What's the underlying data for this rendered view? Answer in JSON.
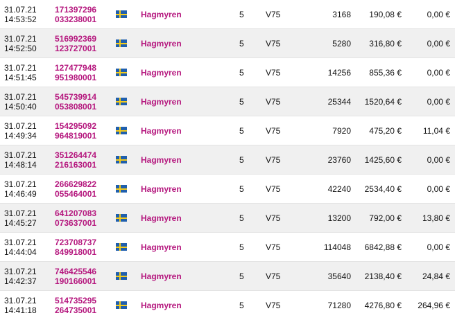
{
  "rows": [
    {
      "date": "31.07.21",
      "time": "14:53:52",
      "ticket_line1": "171397296",
      "ticket_line2": "033238001",
      "flag_icon": "sweden-flag-icon",
      "track": "Hagmyren",
      "race": "5",
      "game": "V75",
      "rows": "3168",
      "cost": "190,08 €",
      "winnings": "0,00 €"
    },
    {
      "date": "31.07.21",
      "time": "14:52:50",
      "ticket_line1": "516992369",
      "ticket_line2": "123727001",
      "flag_icon": "sweden-flag-icon",
      "track": "Hagmyren",
      "race": "5",
      "game": "V75",
      "rows": "5280",
      "cost": "316,80 €",
      "winnings": "0,00 €"
    },
    {
      "date": "31.07.21",
      "time": "14:51:45",
      "ticket_line1": "127477948",
      "ticket_line2": "951980001",
      "flag_icon": "sweden-flag-icon",
      "track": "Hagmyren",
      "race": "5",
      "game": "V75",
      "rows": "14256",
      "cost": "855,36 €",
      "winnings": "0,00 €"
    },
    {
      "date": "31.07.21",
      "time": "14:50:40",
      "ticket_line1": "545739914",
      "ticket_line2": "053808001",
      "flag_icon": "sweden-flag-icon",
      "track": "Hagmyren",
      "race": "5",
      "game": "V75",
      "rows": "25344",
      "cost": "1520,64 €",
      "winnings": "0,00 €"
    },
    {
      "date": "31.07.21",
      "time": "14:49:34",
      "ticket_line1": "154295092",
      "ticket_line2": "964819001",
      "flag_icon": "sweden-flag-icon",
      "track": "Hagmyren",
      "race": "5",
      "game": "V75",
      "rows": "7920",
      "cost": "475,20 €",
      "winnings": "11,04 €"
    },
    {
      "date": "31.07.21",
      "time": "14:48:14",
      "ticket_line1": "351264474",
      "ticket_line2": "216163001",
      "flag_icon": "sweden-flag-icon",
      "track": "Hagmyren",
      "race": "5",
      "game": "V75",
      "rows": "23760",
      "cost": "1425,60 €",
      "winnings": "0,00 €"
    },
    {
      "date": "31.07.21",
      "time": "14:46:49",
      "ticket_line1": "266629822",
      "ticket_line2": "055464001",
      "flag_icon": "sweden-flag-icon",
      "track": "Hagmyren",
      "race": "5",
      "game": "V75",
      "rows": "42240",
      "cost": "2534,40 €",
      "winnings": "0,00 €"
    },
    {
      "date": "31.07.21",
      "time": "14:45:27",
      "ticket_line1": "641207083",
      "ticket_line2": "073637001",
      "flag_icon": "sweden-flag-icon",
      "track": "Hagmyren",
      "race": "5",
      "game": "V75",
      "rows": "13200",
      "cost": "792,00 €",
      "winnings": "13,80 €"
    },
    {
      "date": "31.07.21",
      "time": "14:44:04",
      "ticket_line1": "723708737",
      "ticket_line2": "849918001",
      "flag_icon": "sweden-flag-icon",
      "track": "Hagmyren",
      "race": "5",
      "game": "V75",
      "rows": "114048",
      "cost": "6842,88 €",
      "winnings": "0,00 €"
    },
    {
      "date": "31.07.21",
      "time": "14:42:37",
      "ticket_line1": "746425546",
      "ticket_line2": "190166001",
      "flag_icon": "sweden-flag-icon",
      "track": "Hagmyren",
      "race": "5",
      "game": "V75",
      "rows": "35640",
      "cost": "2138,40 €",
      "winnings": "24,84 €"
    },
    {
      "date": "31.07.21",
      "time": "14:41:18",
      "ticket_line1": "514735295",
      "ticket_line2": "264735001",
      "flag_icon": "sweden-flag-icon",
      "track": "Hagmyren",
      "race": "5",
      "game": "V75",
      "rows": "71280",
      "cost": "4276,80 €",
      "winnings": "264,96 €"
    }
  ],
  "colors": {
    "link": "#b5177e",
    "stripe": "#f0f0f0",
    "flag_blue": "#1f5fae",
    "flag_yellow": "#f5cc1c"
  }
}
